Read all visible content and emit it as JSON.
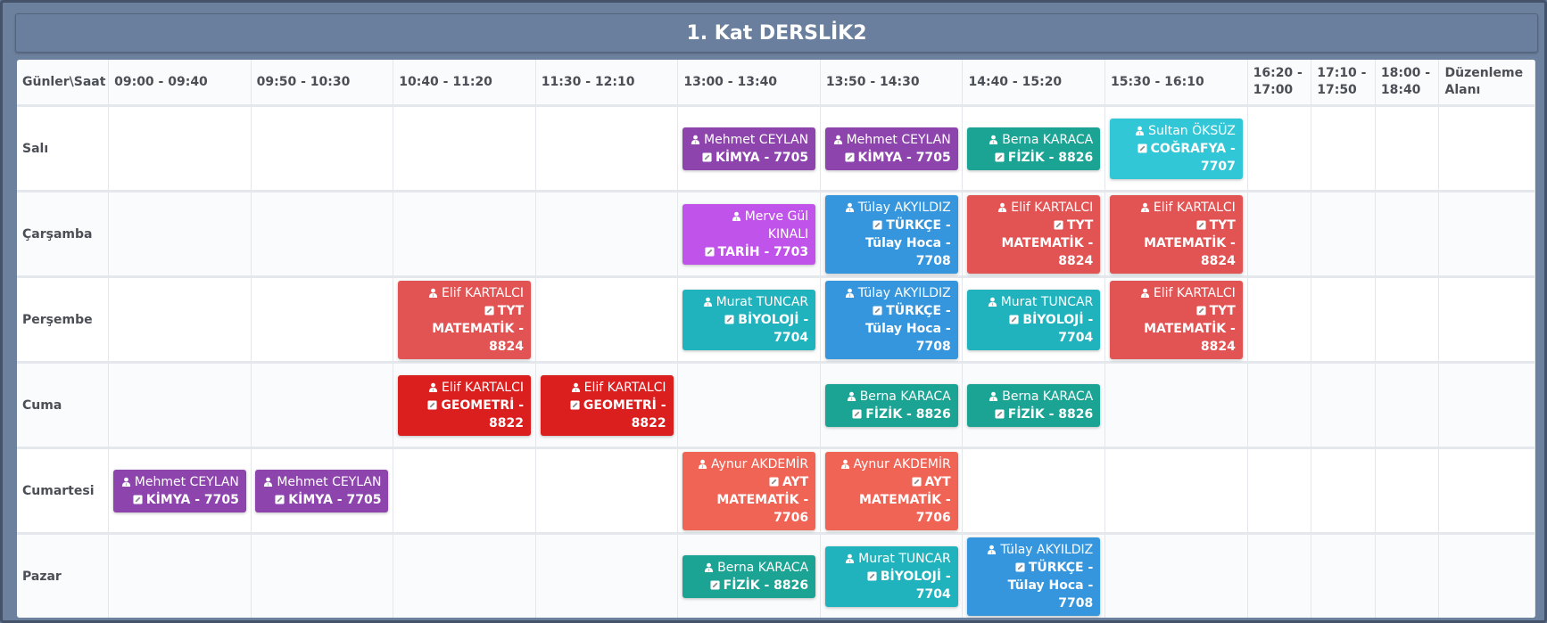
{
  "title": "1. Kat DERSLİK2",
  "header_corner": "Günler\\Saat",
  "time_slots": [
    "09:00 - 09:40",
    "09:50 - 10:30",
    "10:40 - 11:20",
    "11:30 - 12:10",
    "13:00 - 13:40",
    "13:50 - 14:30",
    "14:40 - 15:20",
    "15:30 - 16:10",
    "16:20 - 17:00",
    "17:10 - 17:50",
    "18:00 - 18:40"
  ],
  "edit_column": "Düzenleme Alanı",
  "icons": {
    "teacher": "user-icon",
    "course": "edit-icon"
  },
  "days": [
    {
      "name": "Salı",
      "slots": [
        null,
        null,
        null,
        null,
        {
          "teacher": "Mehmet CEYLAN",
          "course": "KİMYA - 7705",
          "color": "#8e44ad"
        },
        {
          "teacher": "Mehmet CEYLAN",
          "course": "KİMYA - 7705",
          "color": "#8e44ad"
        },
        {
          "teacher": "Berna KARACA",
          "course": "FİZİK - 8826",
          "color": "#1ba394"
        },
        {
          "teacher": "Sultan ÖKSÜZ",
          "course": "COĞRAFYA - 7707",
          "color": "#31c7d6"
        },
        null,
        null,
        null
      ]
    },
    {
      "name": "Çarşamba",
      "slots": [
        null,
        null,
        null,
        null,
        {
          "teacher": "Merve Gül KINALI",
          "course": "TARİH - 7703",
          "color": "#c053ea"
        },
        {
          "teacher": "Tülay AKYILDIZ",
          "course": "TÜRKÇE - Tülay Hoca - 7708",
          "color": "#3596dd"
        },
        {
          "teacher": "Elif KARTALCI",
          "course": "TYT MATEMATİK - 8824",
          "color": "#e25454"
        },
        {
          "teacher": "Elif KARTALCI",
          "course": "TYT MATEMATİK - 8824",
          "color": "#e25454"
        },
        null,
        null,
        null
      ]
    },
    {
      "name": "Perşembe",
      "slots": [
        null,
        null,
        {
          "teacher": "Elif KARTALCI",
          "course": "TYT MATEMATİK - 8824",
          "color": "#e25454"
        },
        null,
        {
          "teacher": "Murat TUNCAR",
          "course": "BİYOLOJİ - 7704",
          "color": "#20b3bd"
        },
        {
          "teacher": "Tülay AKYILDIZ",
          "course": "TÜRKÇE - Tülay Hoca - 7708",
          "color": "#3596dd"
        },
        {
          "teacher": "Murat TUNCAR",
          "course": "BİYOLOJİ - 7704",
          "color": "#20b3bd"
        },
        {
          "teacher": "Elif KARTALCI",
          "course": "TYT MATEMATİK - 8824",
          "color": "#e25454"
        },
        null,
        null,
        null
      ]
    },
    {
      "name": "Cuma",
      "slots": [
        null,
        null,
        {
          "teacher": "Elif KARTALCI",
          "course": "GEOMETRİ - 8822",
          "color": "#db1f1f"
        },
        {
          "teacher": "Elif KARTALCI",
          "course": "GEOMETRİ - 8822",
          "color": "#db1f1f"
        },
        null,
        {
          "teacher": "Berna KARACA",
          "course": "FİZİK - 8826",
          "color": "#1ba394"
        },
        {
          "teacher": "Berna KARACA",
          "course": "FİZİK - 8826",
          "color": "#1ba394"
        },
        null,
        null,
        null,
        null
      ]
    },
    {
      "name": "Cumartesi",
      "slots": [
        {
          "teacher": "Mehmet CEYLAN",
          "course": "KİMYA - 7705",
          "color": "#8e44ad"
        },
        {
          "teacher": "Mehmet CEYLAN",
          "course": "KİMYA - 7705",
          "color": "#8e44ad"
        },
        null,
        null,
        {
          "teacher": "Aynur AKDEMİR",
          "course": "AYT MATEMATİK - 7706",
          "color": "#f06456"
        },
        {
          "teacher": "Aynur AKDEMİR",
          "course": "AYT MATEMATİK - 7706",
          "color": "#f06456"
        },
        null,
        null,
        null,
        null,
        null
      ]
    },
    {
      "name": "Pazar",
      "slots": [
        null,
        null,
        null,
        null,
        {
          "teacher": "Berna KARACA",
          "course": "FİZİK - 8826",
          "color": "#1ba394"
        },
        {
          "teacher": "Murat TUNCAR",
          "course": "BİYOLOJİ - 7704",
          "color": "#20b3bd"
        },
        {
          "teacher": "Tülay AKYILDIZ",
          "course": "TÜRKÇE - Tülay Hoca - 7708",
          "color": "#3596dd"
        },
        null,
        null,
        null,
        null
      ]
    }
  ]
}
